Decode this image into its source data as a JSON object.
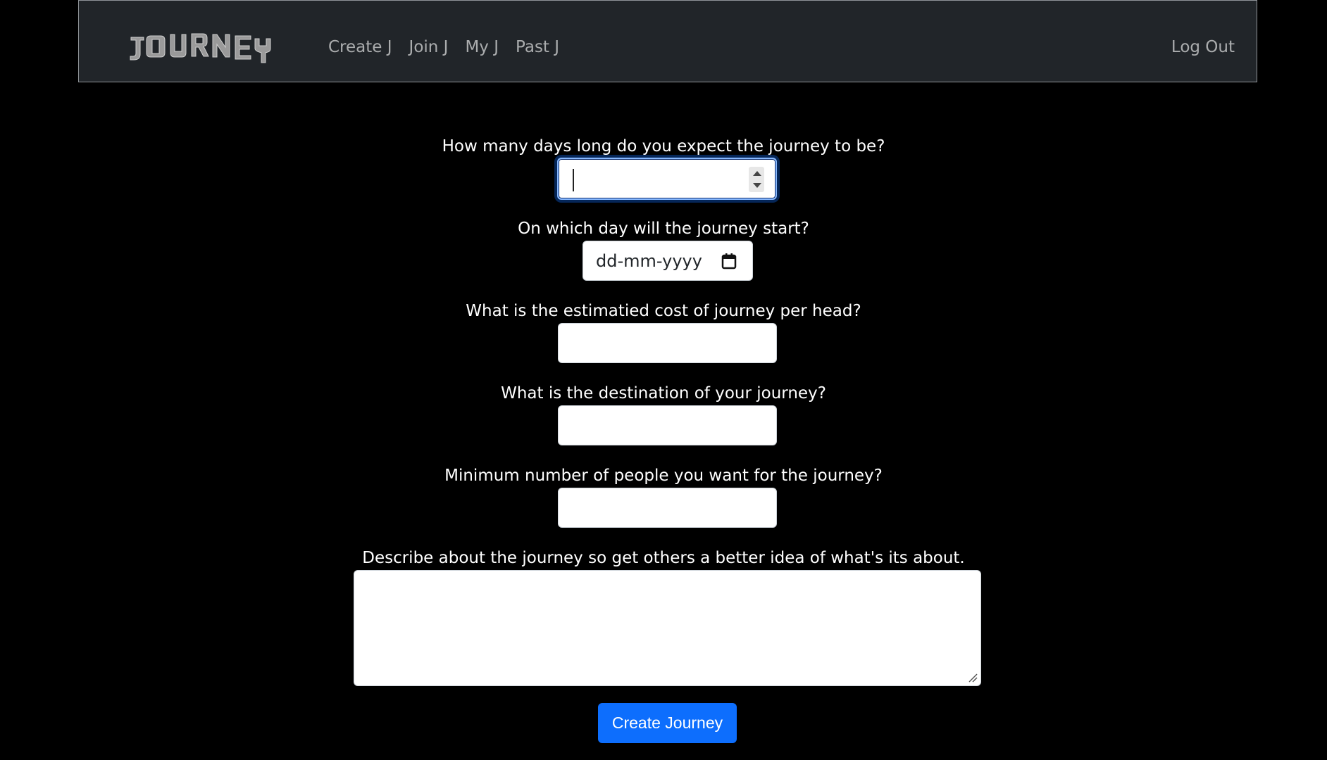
{
  "navbar": {
    "logo_text": "JOURNEY",
    "links": [
      {
        "label": "Create J"
      },
      {
        "label": "Join J"
      },
      {
        "label": "My J"
      },
      {
        "label": "Past J"
      }
    ],
    "logout_label": "Log Out"
  },
  "form": {
    "q_days": "How many days long do you expect the journey to be?",
    "days_value": "",
    "q_start": "On which day will the journey start?",
    "start_placeholder": "dd-mm-yyyy",
    "q_cost": "What is the estimatied cost of journey per head?",
    "cost_value": "",
    "q_destination": "What is the destination of your journey?",
    "destination_value": "",
    "q_min_people": "Minimum number of people you want for the journey?",
    "min_people_value": "",
    "q_description": "Describe about the journey so get others a better idea of what's its about.",
    "description_value": "",
    "submit_label": "Create Journey"
  },
  "colors": {
    "background": "#000000",
    "navbar_bg": "#212529",
    "primary_button": "#0d6efd",
    "nav_link": "rgba(255,255,255,0.62)"
  }
}
